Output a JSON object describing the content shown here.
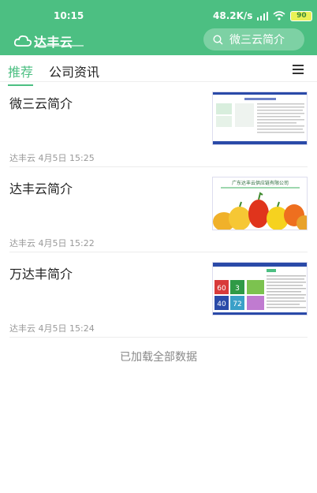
{
  "status": {
    "time": "10:15",
    "speed": "48.2K/s",
    "battery": "90"
  },
  "header": {
    "logo_text": "达丰云",
    "search_text": "微三云简介"
  },
  "tabs": [
    {
      "label": "推荐"
    },
    {
      "label": "公司资讯"
    }
  ],
  "articles": [
    {
      "title": "微三云简介",
      "meta": "达丰云 4月5日 15:25",
      "thumb": "doc-thumbnail"
    },
    {
      "title": "达丰云简介",
      "meta": "达丰云 4月5日 15:22",
      "thumb": "peppers-thumbnail",
      "thumb_caption": "广东达丰云供应链有限公司"
    },
    {
      "title": "万达丰简介",
      "meta": "达丰云 4月5日 15:24",
      "thumb": "stats-thumbnail",
      "stats": [
        "60",
        "3",
        "40",
        "72"
      ]
    }
  ],
  "footer": {
    "end_note": "已加载全部数据"
  },
  "colors": {
    "brand": "#4cbf82",
    "text": "#222222",
    "meta": "#999999"
  }
}
